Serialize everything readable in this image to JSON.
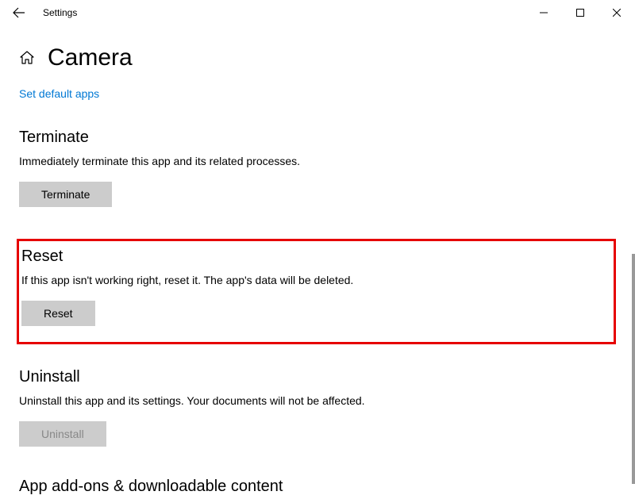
{
  "window": {
    "title": "Settings"
  },
  "header": {
    "title": "Camera"
  },
  "link": {
    "set_default": "Set default apps"
  },
  "terminate": {
    "heading": "Terminate",
    "description": "Immediately terminate this app and its related processes.",
    "button": "Terminate"
  },
  "reset": {
    "heading": "Reset",
    "description": "If this app isn't working right, reset it. The app's data will be deleted.",
    "button": "Reset"
  },
  "uninstall": {
    "heading": "Uninstall",
    "description": "Uninstall this app and its settings. Your documents will not be affected.",
    "button": "Uninstall"
  },
  "cutoff": {
    "heading": "App add-ons & downloadable content"
  }
}
